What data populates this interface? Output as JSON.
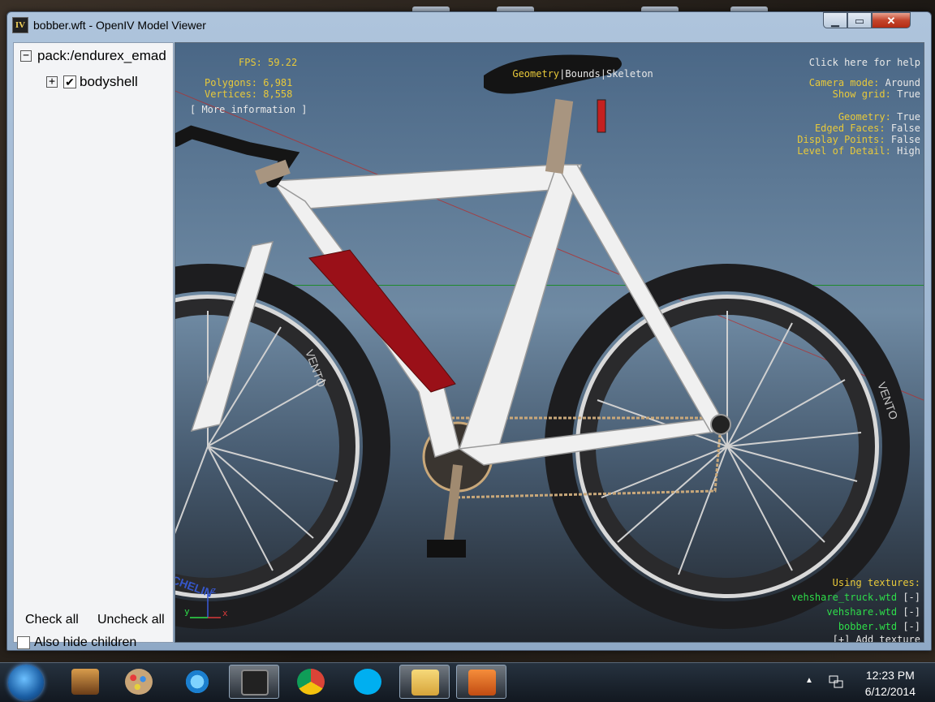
{
  "window": {
    "title": "bobber.wft - OpenIV Model Viewer",
    "app_icon_label": "IV",
    "minimize": "▁",
    "maximize": "▭",
    "close": "✕"
  },
  "tree": {
    "root": {
      "toggle": "−",
      "label": "pack:/endurex_emad"
    },
    "child": {
      "toggle": "+",
      "check": "✔",
      "label": "bodyshell"
    }
  },
  "panel_buttons": {
    "check_all": "Check all",
    "uncheck_all": "Uncheck all"
  },
  "also_hide_children": "Also hide children",
  "hud": {
    "fps": "FPS: 59.22",
    "polygons": "Polygons: 6,981",
    "vertices": "Vertices: 8,558",
    "more_info": "[ More information ]",
    "tabs": {
      "geometry": "Geometry",
      "bounds": "Bounds",
      "skeleton": "Skeleton",
      "sep": "|"
    },
    "help": "Click here for help",
    "settings": [
      {
        "key": "Camera mode:",
        "value": "Around"
      },
      {
        "key": "Show grid:",
        "value": "True"
      },
      {
        "key": "Geometry:",
        "value": "True"
      },
      {
        "key": "Edged Faces:",
        "value": "False"
      },
      {
        "key": "Display Points:",
        "value": "False"
      },
      {
        "key": "Level of Detail:",
        "value": "High"
      }
    ],
    "using_textures": "Using textures:",
    "textures": [
      {
        "name": "vehshare_truck.wtd",
        "action": "[-]"
      },
      {
        "name": "vehshare.wtd",
        "action": "[-]"
      },
      {
        "name": "bobber.wtd",
        "action": "[-]"
      }
    ],
    "add_texture": "[+] Add texture",
    "axes": {
      "x": "x",
      "y": "y",
      "z": "z"
    }
  },
  "bike_decals": {
    "rim_text": "VENTO",
    "tire_text": "MICHELIN"
  },
  "colors": {
    "hud_yellow": "#e8c93a",
    "hud_green": "#2ede4a",
    "frame_white": "#f2f2f2",
    "accent_red": "#b5121b"
  },
  "taskbar": {
    "time": "12:23 PM",
    "date": "6/12/2014",
    "items": [
      "windows-start-icon",
      "gta-icon",
      "paint-icon",
      "internet-explorer-icon",
      "openiv-icon",
      "chrome-icon",
      "skype-icon",
      "file-explorer-icon",
      "media-player-icon"
    ]
  }
}
